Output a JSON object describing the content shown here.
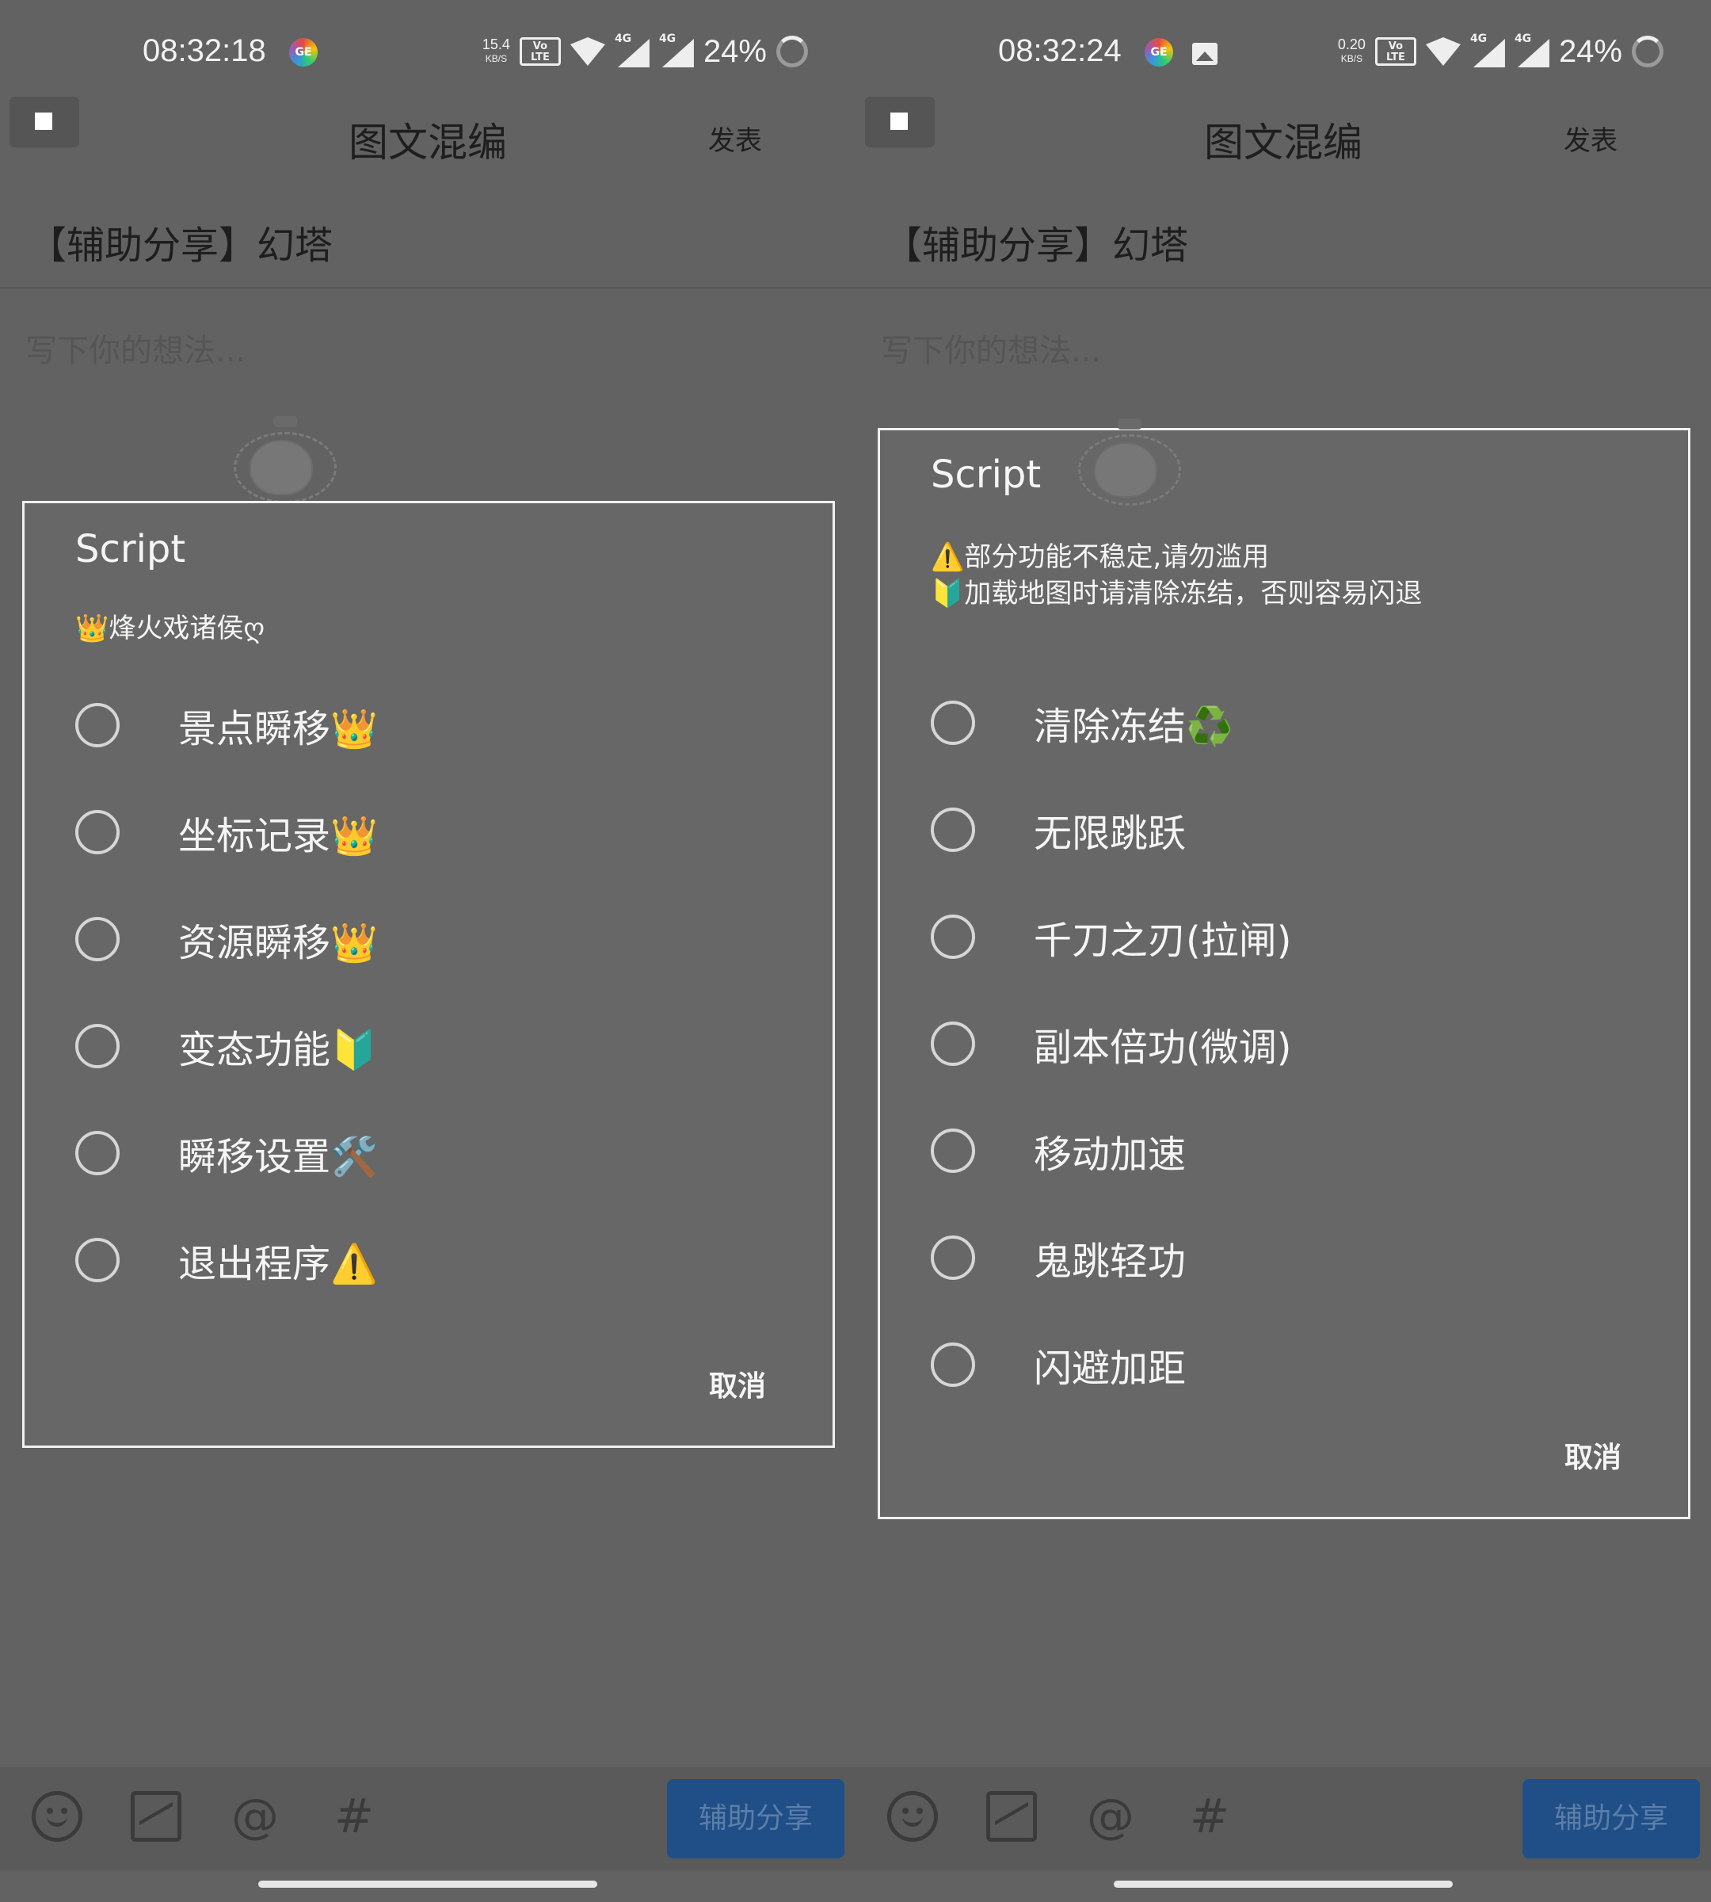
{
  "left": {
    "status": {
      "time": "08:32:18",
      "speed_value": "15.4",
      "speed_unit": "KB/S",
      "volte": "Vo LTE",
      "net_a": "4G",
      "net_b": "4G",
      "battery": "24%",
      "app_badge": "GE"
    },
    "header": {
      "title": "图文混编",
      "publish": "发表"
    },
    "post": {
      "title": "【辅助分享】幻塔",
      "placeholder": "写下你的想法..."
    },
    "dialog": {
      "title": "Script",
      "note": "👑烽火戏诸侯ღ",
      "options": [
        "景点瞬移👑",
        "坐标记录👑",
        "资源瞬移👑",
        "变态功能🔰",
        "瞬移设置🛠️",
        "退出程序⚠️"
      ],
      "cancel": "取消"
    },
    "toolbar": {
      "share": "辅助分享",
      "at": "@",
      "hash": "#"
    }
  },
  "right": {
    "status": {
      "time": "08:32:24",
      "speed_value": "0.20",
      "speed_unit": "KB/S",
      "volte": "Vo LTE",
      "net_a": "4G",
      "net_b": "4G",
      "battery": "24%",
      "app_badge": "GE"
    },
    "header": {
      "title": "图文混编",
      "publish": "发表"
    },
    "post": {
      "title": "【辅助分享】幻塔",
      "placeholder": "写下你的想法..."
    },
    "dialog": {
      "title": "Script",
      "note_line1": "⚠️部分功能不稳定,请勿滥用",
      "note_line2": "🔰加载地图时请清除冻结，否则容易闪退",
      "options": [
        "清除冻结♻️",
        "无限跳跃",
        "千刀之刃(拉闸)",
        "副本倍功(微调)",
        "移动加速",
        "鬼跳轻功",
        "闪避加距"
      ],
      "cancel": "取消"
    },
    "toolbar": {
      "share": "辅助分享",
      "at": "@",
      "hash": "#"
    }
  },
  "colors": {
    "accent_button": "#1f4f86",
    "dialog_border": "#f0f0f0",
    "background": "#626262"
  },
  "icons": [
    "stop-icon",
    "smile-icon",
    "image-icon",
    "at-icon",
    "hash-icon",
    "wifi-icon",
    "signal-icon",
    "battery-icon",
    "gallery-notification-icon"
  ]
}
